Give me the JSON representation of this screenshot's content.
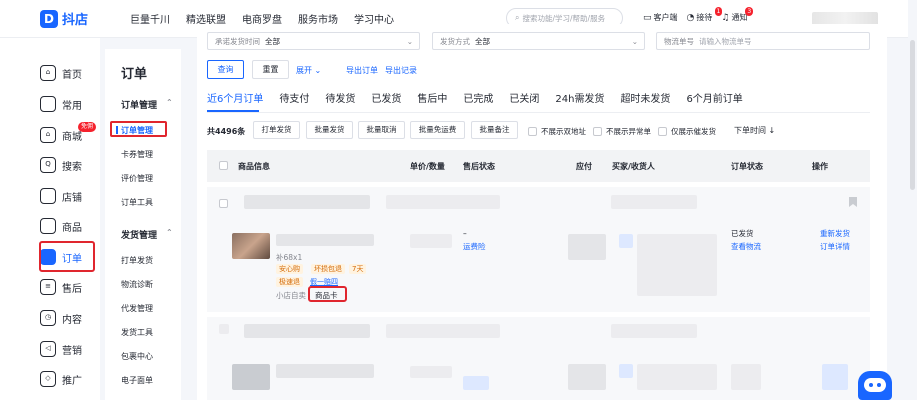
{
  "brand": {
    "logo_text": "抖店"
  },
  "topnav": [
    "巨量千川",
    "精选联盟",
    "电商罗盘",
    "服务市场",
    "学习中心"
  ],
  "search": {
    "placeholder": "搜索功能/学习/帮助/服务"
  },
  "top_icons": [
    {
      "icon": "monitor-icon",
      "label": "客户端"
    },
    {
      "icon": "headset-icon",
      "label": "接待",
      "badge": "1"
    },
    {
      "icon": "bell-icon",
      "label": "通知",
      "badge": "3"
    }
  ],
  "sidebar": {
    "items": [
      {
        "icon": "home-icon",
        "label": "首页"
      },
      {
        "icon": "folder-icon",
        "label": "常用"
      },
      {
        "icon": "shop-icon",
        "label": "商城",
        "badge": "免佣"
      },
      {
        "icon": "search-icon",
        "label": "搜索"
      },
      {
        "icon": "store-icon",
        "label": "店铺"
      },
      {
        "icon": "goods-icon",
        "label": "商品"
      },
      {
        "icon": "order-icon",
        "label": "订单"
      },
      {
        "icon": "after-sale-icon",
        "label": "售后"
      },
      {
        "icon": "content-icon",
        "label": "内容"
      },
      {
        "icon": "megaphone-icon",
        "label": "营销"
      },
      {
        "icon": "promote-icon",
        "label": "推广"
      }
    ]
  },
  "subnav": {
    "title": "订单",
    "groups": [
      {
        "label": "订单管理",
        "items": [
          "订单管理",
          "卡券管理",
          "评价管理",
          "订单工具"
        ]
      },
      {
        "label": "发货管理",
        "items": [
          "打单发货",
          "物流诊断",
          "代发管理",
          "发货工具",
          "包裹中心",
          "电子面单"
        ]
      }
    ]
  },
  "filters": [
    {
      "label": "承诺发货时间",
      "value": "全部"
    },
    {
      "label": "发货方式",
      "value": "全部"
    },
    {
      "label": "物流单号",
      "value": "请输入物流单号"
    }
  ],
  "actions": {
    "query": "查询",
    "reset": "重置",
    "expand": "展开",
    "export_orders": "导出订单",
    "export_records": "导出记录"
  },
  "tabs": [
    "近6个月订单",
    "待支付",
    "待发货",
    "已发货",
    "售后中",
    "已完成",
    "已关闭",
    "24h需发货",
    "超时未发货",
    "6个月前订单"
  ],
  "bulk": {
    "count": "共4496条",
    "buttons": [
      "打单发货",
      "批量发货",
      "批量取消",
      "批量免运费",
      "批量备注"
    ],
    "checks": [
      "不展示双地址",
      "不展示异常单",
      "仅展示催发货"
    ],
    "sort": "下单时间"
  },
  "table_headers": [
    "商品信息",
    "单价/数量",
    "售后状态",
    "应付",
    "买家/收货人",
    "订单状态",
    "操作"
  ],
  "order": {
    "sku_extra": "补68x1",
    "tags": [
      "安心购",
      "坏损包退",
      "7天",
      "极速退",
      "假一赔四"
    ],
    "shop_label": "小店自卖",
    "card_label": "商品卡",
    "after_sale": "–",
    "shipping_insurance": "运费险",
    "status": "已发货",
    "view_logistics": "查看物流",
    "reship": "重新发货",
    "detail": "订单详情"
  },
  "colors": {
    "accent": "#1966ff",
    "highlight": "#e0262e",
    "badge": "#f5222d"
  }
}
